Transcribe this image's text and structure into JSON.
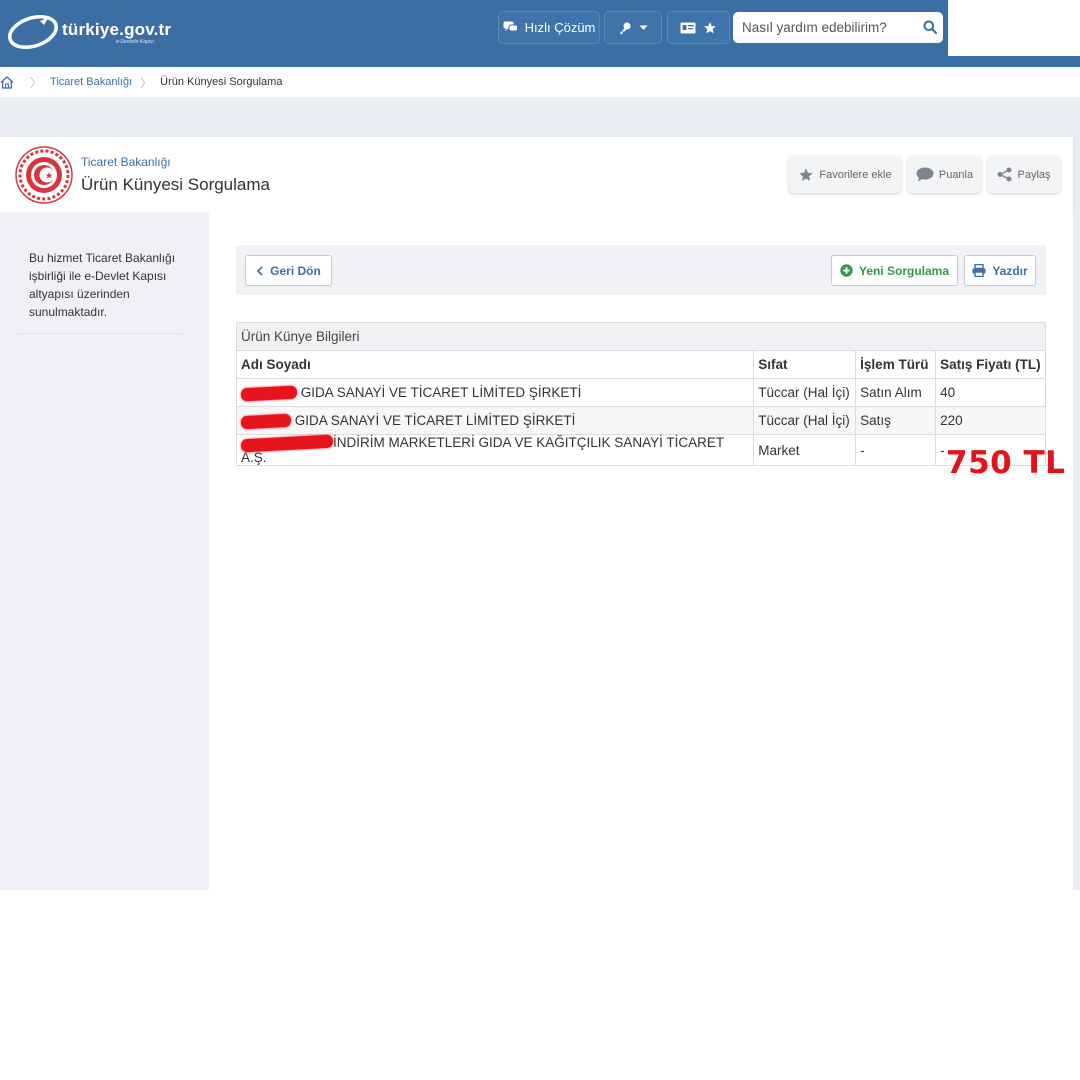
{
  "header": {
    "logo_text": "türkiye.gov.tr",
    "logo_tagline": "e-Devletin Kapısı",
    "quick_solution_label": "Hızlı Çözüm",
    "search_placeholder": "Nasıl yardım edebilirim?"
  },
  "breadcrumb": {
    "items": [
      "Ticaret Bakanlığı",
      "Ürün Künyesi Sorgulama"
    ]
  },
  "page": {
    "department": "Ticaret Bakanlığı",
    "title": "Ürün Künyesi Sorgulama",
    "actions": {
      "favorite_label": "Favorilere ekle",
      "rate_label": "Puanla",
      "share_label": "Paylaş"
    }
  },
  "sidebar": {
    "info_text": "Bu hizmet Ticaret Bakanlığı işbirliği ile e-Devlet Kapısı altyapısı üzerinden sunulmaktadır."
  },
  "toolbar": {
    "back_label": "Geri Dön",
    "new_query_label": "Yeni Sorgulama",
    "print_label": "Yazdır"
  },
  "table": {
    "caption": "Ürün Künye Bilgileri",
    "columns": [
      "Adı Soyadı",
      "Sıfat",
      "İşlem Türü",
      "Satış Fiyatı (TL)"
    ],
    "rows": [
      {
        "name": "GIDA SANAYİ VE TİCARET LİMİTED ŞİRKETİ",
        "role": "Tüccar (Hal İçi)",
        "transaction": "Satın Alım",
        "price": "40"
      },
      {
        "name": "GIDA SANAYİ VE TİCARET LİMİTED ŞİRKETİ",
        "role": "Tüccar (Hal İçi)",
        "transaction": "Satış",
        "price": "220"
      },
      {
        "name": "İNDİRİM MARKETLERİ GIDA VE KAĞITÇILIK SANAYİ TİCARET A.Ş.",
        "role": "Market",
        "transaction": "-",
        "price": "-"
      }
    ]
  },
  "annotation": {
    "price_text": "750 TL",
    "color": "#e3131b"
  },
  "colors": {
    "brand_blue": "#3b6fa4",
    "success_green": "#2e9a4a",
    "redaction_red": "#e8141b"
  }
}
